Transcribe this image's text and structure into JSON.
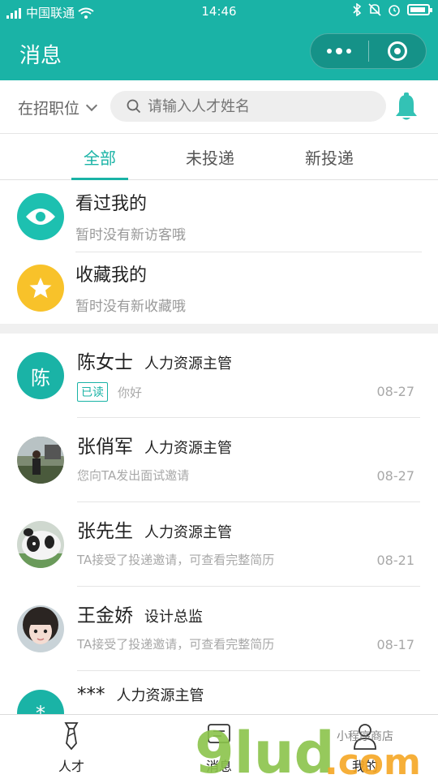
{
  "status_bar": {
    "carrier": "中国联通",
    "time": "14:46"
  },
  "header": {
    "title": "消息"
  },
  "search_row": {
    "filter_label": "在招职位",
    "search_placeholder": "请输入人才姓名"
  },
  "tabs": [
    {
      "label": "全部",
      "active": true
    },
    {
      "label": "未投递",
      "active": false
    },
    {
      "label": "新投递",
      "active": false
    }
  ],
  "visitors": [
    {
      "title": "看过我的",
      "subtitle": "暂时没有新访客哦",
      "icon": "eye-icon",
      "color": "#1dc0b0"
    },
    {
      "title": "收藏我的",
      "subtitle": "暂时没有新收藏哦",
      "icon": "star-icon",
      "color": "#f8c22a"
    }
  ],
  "conversations": [
    {
      "name": "陈女士",
      "position": "人力资源主管",
      "badge": "已读",
      "message": "你好",
      "date": "08-27",
      "avatar_text": "陈",
      "avatar_color": "#1ab3a6"
    },
    {
      "name": "张俏军",
      "position": "人力资源主管",
      "message": "您向TA发出面试邀请",
      "date": "08-27",
      "avatar_kind": "photo-outdoor"
    },
    {
      "name": "张先生",
      "position": "人力资源主管",
      "message": "TA接受了投递邀请，可查看完整简历",
      "date": "08-21",
      "avatar_kind": "panda"
    },
    {
      "name": "王金娇",
      "position": "设计总监",
      "message": "TA接受了投递邀请，可查看完整简历",
      "date": "08-17",
      "avatar_kind": "photo-girl"
    },
    {
      "name": "***",
      "position": "人力资源主管",
      "avatar_text": "*",
      "avatar_color": "#1ab3a6"
    }
  ],
  "tab_bar": [
    {
      "label": "人才",
      "icon": "tie-icon"
    },
    {
      "label": "消息",
      "icon": "chat-icon"
    },
    {
      "label": "我的",
      "icon": "person-icon"
    }
  ],
  "watermark": {
    "text": "9lud.com",
    "subtext": "小程序商店"
  },
  "colors": {
    "brand": "#1ab3a6",
    "star": "#f8c22a"
  }
}
